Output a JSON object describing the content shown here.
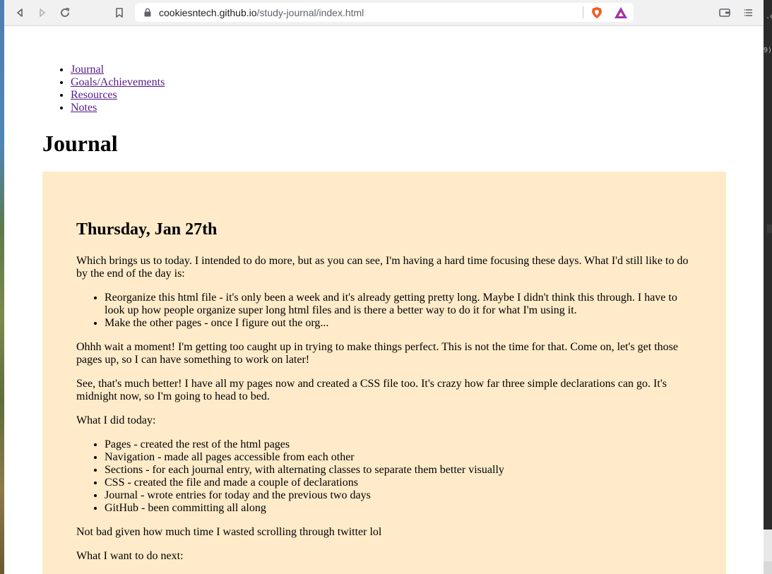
{
  "browser": {
    "url_host": "cookiesntech.github.io",
    "url_path": "/study-journal/index.html"
  },
  "desktop": {
    "right_text_1": ".c",
    "right_text_2": "9)"
  },
  "nav": {
    "items": [
      {
        "label": "Journal"
      },
      {
        "label": "Goals/Achievements"
      },
      {
        "label": "Resources"
      },
      {
        "label": "Notes"
      }
    ]
  },
  "page": {
    "title": "Journal"
  },
  "entry": {
    "heading": "Thursday, Jan 27th",
    "p1": "Which brings us to today. I intended to do more, but as you can see, I'm having a hard time focusing these days. What I'd still like to do by the end of the day is:",
    "list1": [
      "Reorganize this html file - it's only been a week and it's already getting pretty long. Maybe I didn't think this through. I have to look up how people organize super long html files and is there a better way to do it for what I'm using it.",
      "Make the other pages - once I figure out the org..."
    ],
    "p2": "Ohhh wait a moment! I'm getting too caught up in trying to make things perfect. This is not the time for that. Come on, let's get those pages up, so I can have something to work on later!",
    "p3": "See, that's much better! I have all my pages now and created a CSS file too. It's crazy how far three simple declarations can go. It's midnight now, so I'm going to head to bed.",
    "p4": "What I did today:",
    "list2": [
      "Pages - created the rest of the html pages",
      "Navigation - made all pages accessible from each other",
      "Sections - for each journal entry, with alternating classes to separate them better visually",
      "CSS - created the file and made a couple of declarations",
      "Journal - wrote entries for today and the previous two days",
      "GitHub - been committing all along"
    ],
    "p5": "Not bad given how much time I wasted scrolling through twitter lol",
    "p6": "What I want to do next:"
  },
  "colors": {
    "entry_background": "#ffebc9",
    "visited_link": "#551a8b"
  },
  "icons": [
    "back-icon",
    "forward-icon",
    "reload-icon",
    "bookmark-icon",
    "lock-icon",
    "brave-shield-icon",
    "brave-rewards-icon",
    "wallet-icon",
    "menu-icon"
  ]
}
